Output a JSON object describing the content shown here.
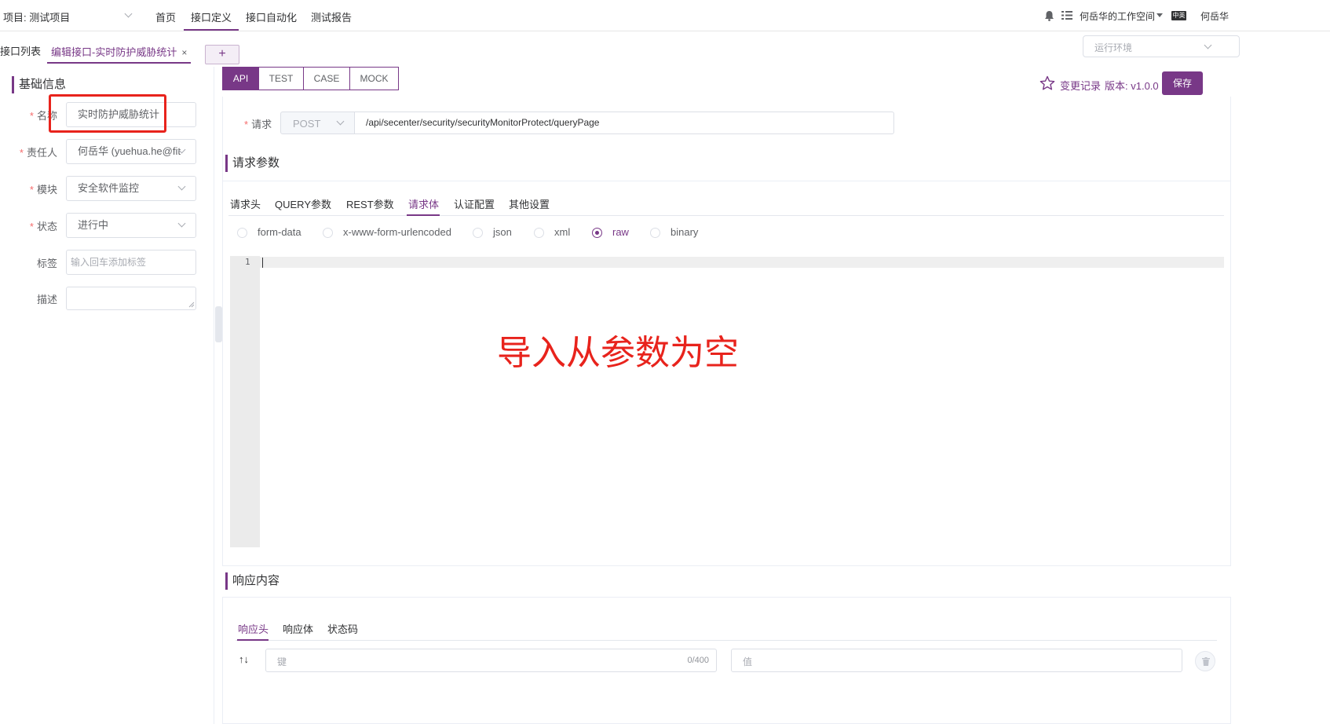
{
  "header": {
    "project_label": "项目: 测试项目",
    "nav": [
      "首页",
      "接口定义",
      "接口自动化",
      "测试报告"
    ],
    "workspace": "何岳华的工作空间",
    "user": "何岳华",
    "lang_icon": "中英"
  },
  "tabs": {
    "list_tab": "接口列表",
    "edit_tab": "编辑接口-实时防护威胁统计",
    "close": "×",
    "add": "+",
    "env_placeholder": "运行环境"
  },
  "basic": {
    "title": "基础信息",
    "name_label": "名称",
    "name_value": "实时防护威胁统计",
    "owner_label": "责任人",
    "owner_value": "何岳华 (yuehua.he@fit",
    "module_label": "模块",
    "module_value": "安全软件监控",
    "status_label": "状态",
    "status_value": "进行中",
    "tag_label": "标签",
    "tag_placeholder": "输入回车添加标签",
    "desc_label": "描述"
  },
  "toolbar": {
    "modes": [
      "API",
      "TEST",
      "CASE",
      "MOCK"
    ],
    "history": "变更记录",
    "version": "版本: v1.0.0",
    "save": "保存"
  },
  "request": {
    "label": "请求",
    "method": "POST",
    "url": "/api/secenter/security/securityMonitorProtect/queryPage"
  },
  "params": {
    "title": "请求参数",
    "tabs": [
      "请求头",
      "QUERY参数",
      "REST参数",
      "请求体",
      "认证配置",
      "其他设置"
    ],
    "active_tab": "请求体",
    "body_types": [
      "form-data",
      "x-www-form-urlencoded",
      "json",
      "xml",
      "raw",
      "binary"
    ],
    "selected_body_type": "raw",
    "line_number": "1",
    "annotation": "导入从参数为空"
  },
  "response": {
    "title": "响应内容",
    "tabs": [
      "响应头",
      "响应体",
      "状态码"
    ],
    "key_placeholder": "键",
    "key_counter": "0/400",
    "value_placeholder": "值",
    "sort_icon": "↑↓"
  },
  "colors": {
    "accent": "#783887",
    "annotation_red": "#e8231c"
  }
}
